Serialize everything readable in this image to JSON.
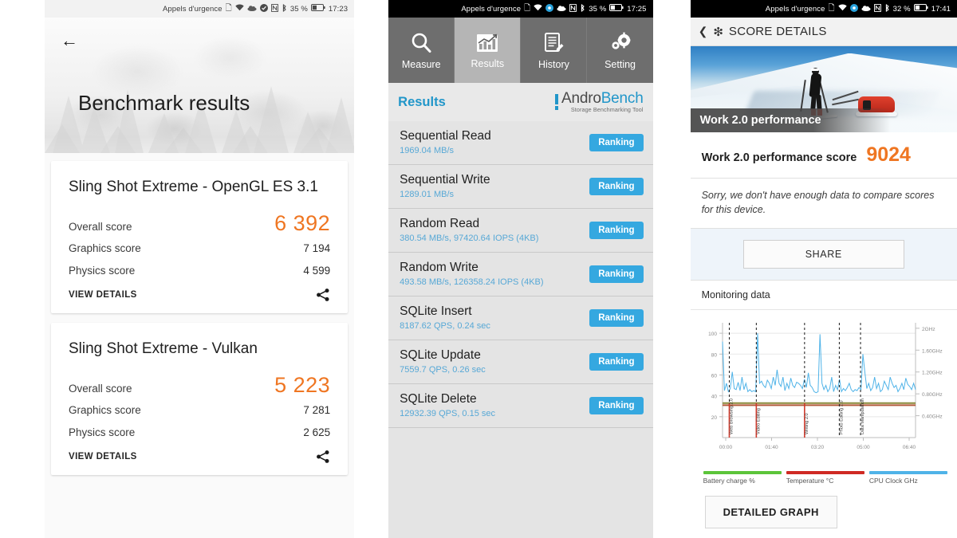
{
  "panel1": {
    "statusbar": {
      "carrier": "Appels d'urgence",
      "battery": "35 %",
      "time": "17:23"
    },
    "back_icon": "back-arrow-icon",
    "title": "Benchmark results",
    "cards": [
      {
        "title": "Sling Shot Extreme - OpenGL ES 3.1",
        "overall_label": "Overall score",
        "overall_value": "6 392",
        "graphics_label": "Graphics score",
        "graphics_value": "7 194",
        "physics_label": "Physics score",
        "physics_value": "4 599",
        "view_details": "VIEW DETAILS",
        "share_icon": "share-icon"
      },
      {
        "title": "Sling Shot Extreme - Vulkan",
        "overall_label": "Overall score",
        "overall_value": "5 223",
        "graphics_label": "Graphics score",
        "graphics_value": "7 281",
        "physics_label": "Physics score",
        "physics_value": "2 625",
        "view_details": "VIEW DETAILS",
        "share_icon": "share-icon"
      }
    ],
    "accent_color": "#ef7622"
  },
  "panel2": {
    "statusbar": {
      "carrier": "Appels d'urgence",
      "battery": "35 %",
      "time": "17:25"
    },
    "tabs": [
      {
        "label": "Measure",
        "icon": "magnifier-icon",
        "active": false
      },
      {
        "label": "Results",
        "icon": "bar-chart-icon",
        "active": true
      },
      {
        "label": "History",
        "icon": "document-pencil-icon",
        "active": false
      },
      {
        "label": "Setting",
        "icon": "gears-icon",
        "active": false
      }
    ],
    "section_title": "Results",
    "logo": {
      "name_part1": "Andro",
      "name_part2": "Bench",
      "tagline": "Storage Benchmarking Tool"
    },
    "ranking_label": "Ranking",
    "accent_color": "#35a8e0",
    "rows": [
      {
        "name": "Sequential Read",
        "value": "1969.04 MB/s"
      },
      {
        "name": "Sequential Write",
        "value": "1289.01 MB/s"
      },
      {
        "name": "Random Read",
        "value": "380.54 MB/s, 97420.64 IOPS (4KB)"
      },
      {
        "name": "Random Write",
        "value": "493.58 MB/s, 126358.24 IOPS (4KB)"
      },
      {
        "name": "SQLite Insert",
        "value": "8187.62 QPS, 0.24 sec"
      },
      {
        "name": "SQLite Update",
        "value": "7559.7 QPS, 0.26 sec"
      },
      {
        "name": "SQLite Delete",
        "value": "12932.39 QPS, 0.15 sec"
      }
    ]
  },
  "panel3": {
    "statusbar": {
      "carrier": "Appels d'urgence",
      "battery": "32 %",
      "time": "17:41"
    },
    "header": {
      "back_icon": "chevron-left-icon",
      "brand_icon": "snowflake-icon",
      "title": "SCORE DETAILS"
    },
    "hero_caption": "Work 2.0 performance",
    "score_label": "Work 2.0 performance score",
    "score_value": "9024",
    "note": "Sorry, we don't have enough data to compare scores for this device.",
    "share_button": "SHARE",
    "monitoring_title": "Monitoring data",
    "detailed_button": "DETAILED GRAPH",
    "accent_color": "#ef7622",
    "legend": [
      {
        "label": "Battery charge %",
        "color": "#5cc43a"
      },
      {
        "label": "Temperature °C",
        "color": "#cf2a24"
      },
      {
        "label": "CPU Clock GHz",
        "color": "#4fb3e8"
      }
    ]
  },
  "chart_data": {
    "type": "line",
    "title": "Monitoring data",
    "xlabel": "",
    "ylabel": "",
    "grid": true,
    "legend_position": "bottom",
    "x_ticks": [
      "00:00",
      "01:40",
      "03:20",
      "05:00",
      "06:40"
    ],
    "y_left_ticks": [
      20,
      40,
      60,
      80,
      100
    ],
    "y_right_ticks": [
      "0.40GHz",
      "0.80GHz",
      "1.20GHz",
      "1.60GHz",
      "2GHz"
    ],
    "ylim_left": [
      0,
      110
    ],
    "ylim_right": [
      0,
      2.2
    ],
    "annotations": [
      {
        "label": "Web Browsing 2.0",
        "x": "00:05"
      },
      {
        "label": "Video Editing",
        "x": "01:12"
      },
      {
        "label": "Writing 2.0",
        "x": "02:52"
      },
      {
        "label": "Photo Editing 2.0",
        "x": "04:06"
      },
      {
        "label": "Data Manipulation",
        "x": "04:52"
      }
    ],
    "series": [
      {
        "name": "CPU Clock GHz",
        "color": "#4fb3e8",
        "axis": "right",
        "values": [
          92,
          45,
          52,
          44,
          47,
          63,
          47,
          46,
          53,
          45,
          58,
          46,
          52,
          44,
          46,
          44,
          45,
          44,
          100,
          52,
          54,
          50,
          48,
          55,
          52,
          47,
          58,
          50,
          65,
          52,
          49,
          58,
          45,
          52,
          47,
          57,
          50,
          48,
          53,
          52,
          50,
          47,
          56,
          48,
          62,
          50,
          48,
          44,
          43,
          44,
          99,
          52,
          46,
          50,
          44,
          47,
          58,
          44,
          50,
          46,
          56,
          44,
          47,
          45,
          48,
          52,
          46,
          44,
          46,
          45,
          48,
          46,
          80,
          63,
          47,
          52,
          45,
          48,
          58,
          47,
          52,
          44,
          46,
          54,
          50,
          46,
          58,
          52,
          48,
          50,
          44,
          47,
          52,
          46,
          57,
          51,
          49,
          46,
          52,
          46
        ]
      },
      {
        "name": "Battery charge %",
        "color": "#8a8a3a",
        "axis": "left",
        "values": [
          33,
          33,
          33,
          33,
          33,
          33,
          33,
          33,
          33,
          33,
          33,
          33,
          33,
          33,
          33,
          33,
          33,
          33,
          33,
          33
        ]
      },
      {
        "name": "Temperature °C",
        "color": "#b35a3a",
        "axis": "left",
        "values": [
          31,
          31,
          31,
          31,
          31,
          31,
          31,
          31,
          31,
          31,
          31,
          31,
          31,
          31,
          31,
          31,
          31,
          31,
          31,
          31
        ]
      }
    ]
  }
}
